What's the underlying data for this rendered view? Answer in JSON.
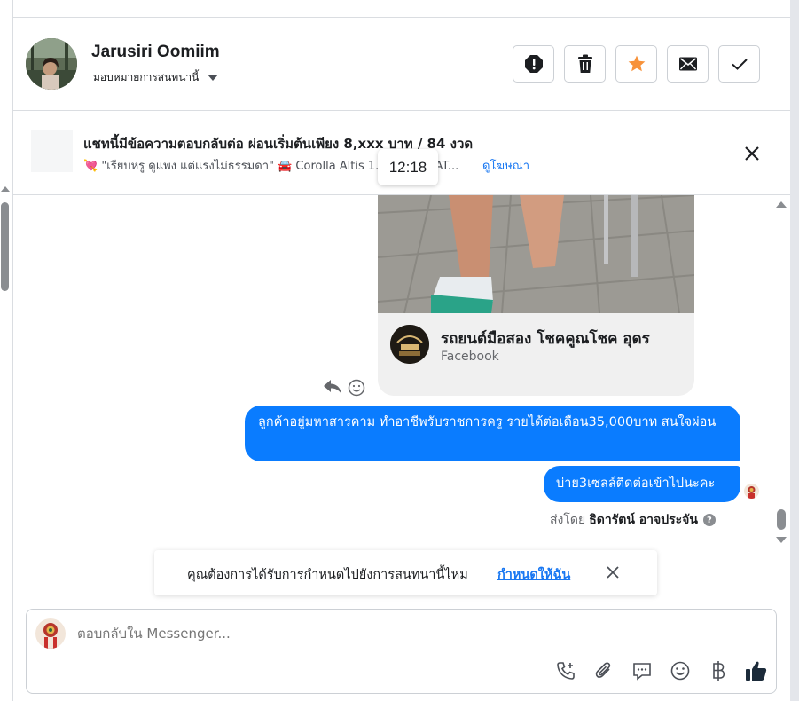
{
  "header": {
    "user_name": "Jarusiri Oomiim",
    "assign_label": "มอบหมายการสนทนานี้"
  },
  "ad": {
    "title": "แชทนี้มีข้อความตอบกลับต่อ ผ่อนเริ่มต้นเพียง 8,xxx บาท / 84 งวด",
    "subtitle": "💘 \"เรียบหรู ดูแพง แต่แรงไม่ธรรมดา\" 🚘 Corolla Altis 1.",
    "subtitle_tail": ") AT...",
    "link": "ดูโฆษณา"
  },
  "tooltip": {
    "time": "12:18"
  },
  "post": {
    "page_name": "รถยนต์มือสอง โชคคูณโชค อุดร",
    "source": "Facebook"
  },
  "messages": [
    {
      "text": "ลูกค้าอยู่มหาสารคาม ทำอาชีพรับราชการครู รายได้ต่อเดือน35,000บาท สนใจผ่อน"
    },
    {
      "text": "บ่าย3เซลล์ติดต่อเข้าไปนะคะ"
    }
  ],
  "sent_by": {
    "prefix": "ส่งโดย",
    "name": "ธิดารัตน์ อาจประจัน",
    "help": "?"
  },
  "toast": {
    "text": "คุณต้องการได้รับการกำหนดไปยังการสนทนานี้ไหม",
    "link": "กำหนดให้ฉัน"
  },
  "composer": {
    "placeholder": "ตอบกลับใน Messenger..."
  },
  "colors": {
    "brand_blue": "#0a7cff",
    "link_blue": "#1877f2",
    "star_orange": "#f7923a"
  },
  "icons": [
    "alert-icon",
    "trash-icon",
    "star-icon",
    "envelope-icon",
    "check-icon",
    "close-icon",
    "reply-icon",
    "smiley-icon",
    "phone-plus-icon",
    "paperclip-icon",
    "chat-bubble-icon",
    "emoji-icon",
    "baht-icon",
    "thumbs-up-icon"
  ]
}
